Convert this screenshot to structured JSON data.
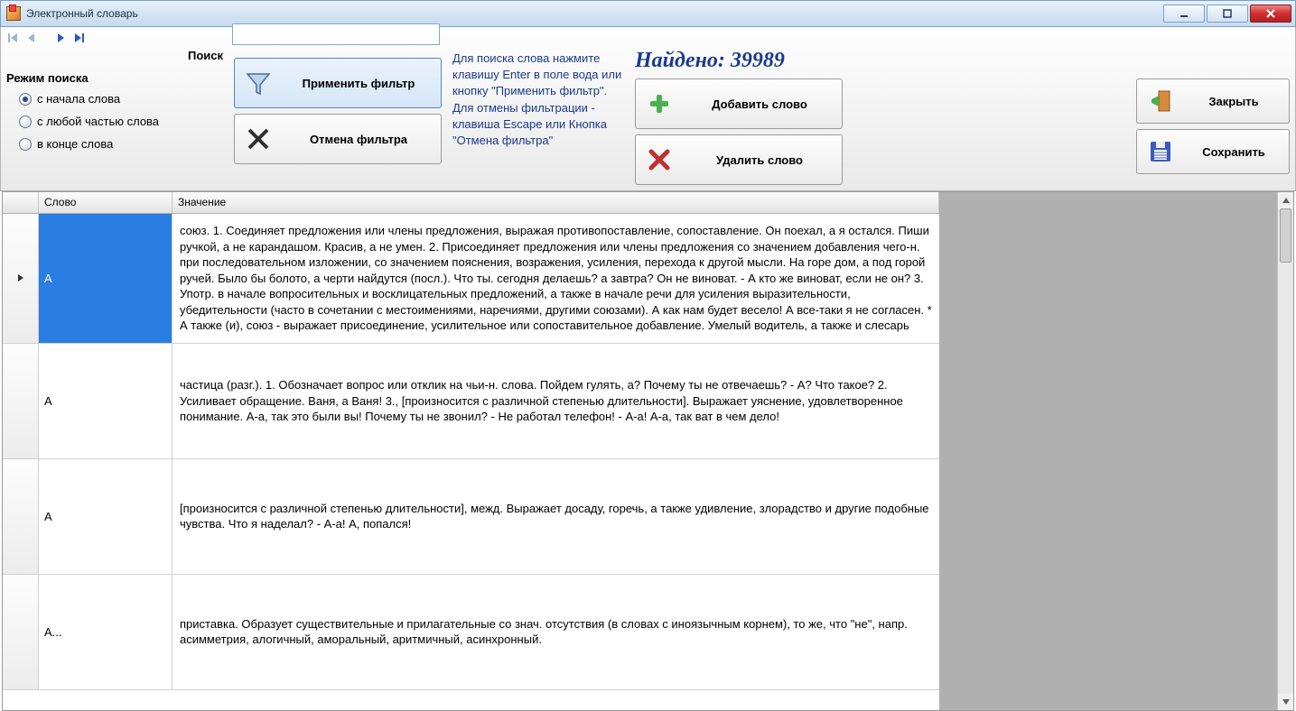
{
  "window": {
    "title": "Электронный словарь"
  },
  "search": {
    "label": "Поиск",
    "value": ""
  },
  "mode": {
    "label": "Режим поиска",
    "opt1": "с начала слова",
    "opt2": "с любой частью слова",
    "opt3": "в конце слова"
  },
  "buttons": {
    "apply_filter": "Применить фильтр",
    "cancel_filter": "Отмена фильтра",
    "add_word": "Добавить слово",
    "delete_word": "Удалить слово",
    "close": "Закрыть",
    "save": "Сохранить"
  },
  "help_text": "Для поиска слова нажмите клавишу Enter в поле вода или кнопку \"Применить фильтр\". Для отмены фильтрации - клавиша Escape или Кнопка \"Отмена фильтра\"",
  "found_label": "Найдено: 39989",
  "columns": {
    "word": "Слово",
    "definition": "Значение"
  },
  "rows": [
    {
      "word": "А",
      "definition": "союз. 1. Соединяет предложения или члены предложения, выражая противопоставление, сопоставление. Он поехал, а я остался. Пиши ручкой, а не карандашом. Красив, а не умен. 2. Присоединяет предложения или члены предложения со значением добавления чего-н. при последовательном изложении, со значением пояснения, возражения, усиления, перехода к другой мысли. На горе дом, а под горой ручей. Было бы болото, а черти найдутся (посл.). Что ты. сегодня делаешь? а завтра? Он не виноват. - А кто же виноват, если не он? 3. Употр. в начале вопросительных и восклицательных предложений, а также в начале речи для усиления выразительности, убедительности (часто в сочетании с местоимениями, наречиями, другими союзами). А как нам будет весело! А все-таки я не согласен. * А также (и), союз - выражает присоединение, усилительное или сопоставительное добавление. Умелый водитель, а также и слесарь"
    },
    {
      "word": "А",
      "definition": "частица (разг.). 1. Обозначает вопрос или отклик на чьи-н. слова. Пойдем гулять, а? Почему ты не отвечаешь? - А? Что такое? 2. Усиливает обращение. Ваня, а Ваня! 3., [произносится с различной степенью длительности]. Выражает уяснение, удовлетворенное понимание. А-а, так это были вы! Почему ты не звонил? - Не работал телефон! - А-а! А-а, так ват в чем дело!"
    },
    {
      "word": "А",
      "definition": "[произносится с различной степенью длительности], межд. Выражает досаду, горечь, а также удивление, злорадство и другие подобные чувства. Что я наделал? - А-а! А, попался!"
    },
    {
      "word": "А...",
      "definition": "приставка. Образует существительные и прилагательные со знач. отсутствия (в словах с иноязычным корнем), то же, что \"не\", напр. асимметрия, алогичный, аморальный, аритмичный, асинхронный."
    }
  ]
}
